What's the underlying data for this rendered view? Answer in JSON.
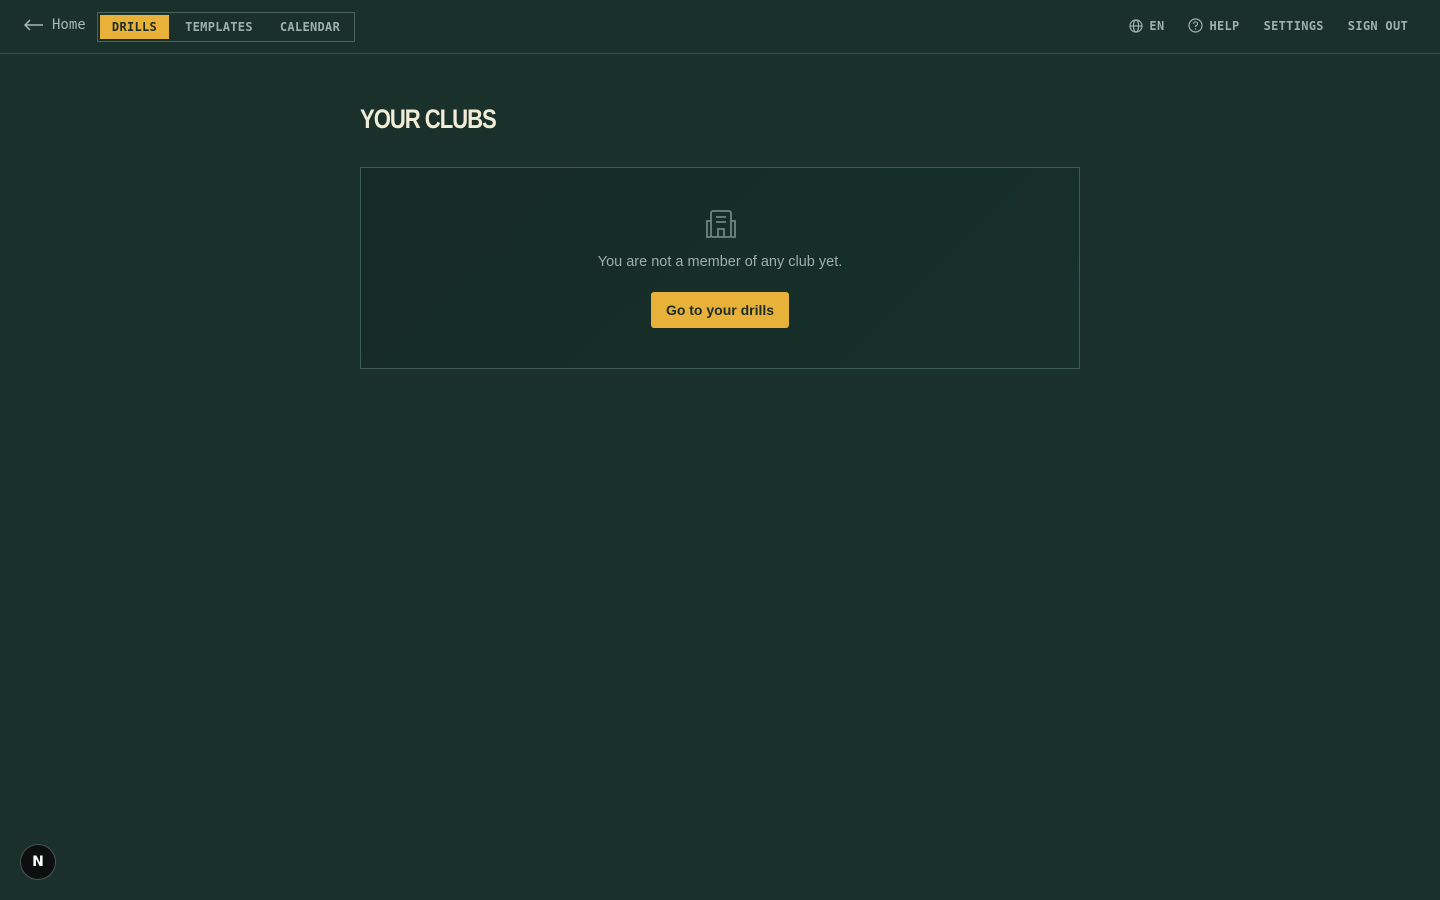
{
  "header": {
    "back_label": "Home",
    "back_icon": "arrow-left-icon",
    "tabs": [
      {
        "label": "DRILLS",
        "active": true
      },
      {
        "label": "TEMPLATES",
        "active": false
      },
      {
        "label": "CALENDAR",
        "active": false
      }
    ],
    "language": {
      "label": "EN",
      "icon": "globe-icon"
    },
    "help": {
      "label": "HELP",
      "icon": "help-circle-icon"
    },
    "settings_label": "SETTINGS",
    "signout_label": "SIGN OUT"
  },
  "main": {
    "title": "YOUR CLUBS",
    "empty_state": {
      "icon": "building-icon",
      "message": "You are not a member of any club yet.",
      "button_label": "Go to your drills"
    }
  },
  "dev_badge": {
    "label": "N"
  },
  "colors": {
    "background": "#19302b",
    "accent": "#e8b23a",
    "title": "#f1ecd6",
    "muted_text": "#9fb0aa"
  }
}
